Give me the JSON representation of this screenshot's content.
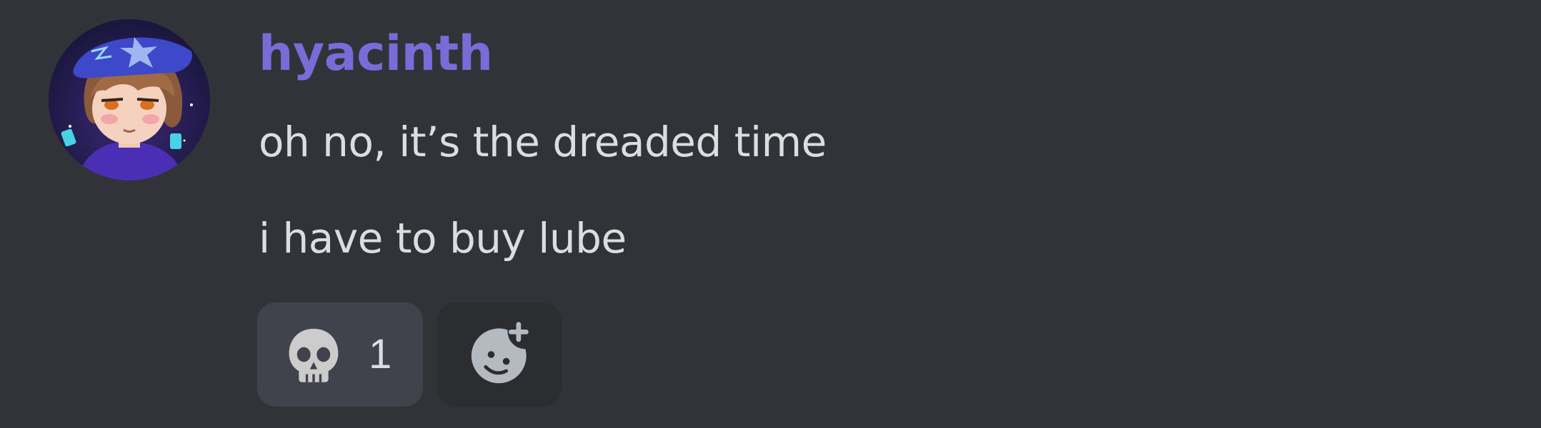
{
  "message": {
    "username": "hyacinth",
    "username_color": "#7a6bd8",
    "lines": [
      "oh no, it’s the dreaded time",
      "i have to buy lube"
    ]
  },
  "reactions": [
    {
      "emoji": "skull-icon",
      "count": "1"
    }
  ],
  "add_reaction": {
    "icon": "add-reaction-icon"
  },
  "colors": {
    "background": "#313338",
    "text": "#dbdee1",
    "reaction_bg": "#40434b",
    "add_reaction_bg": "#2b2d31"
  }
}
